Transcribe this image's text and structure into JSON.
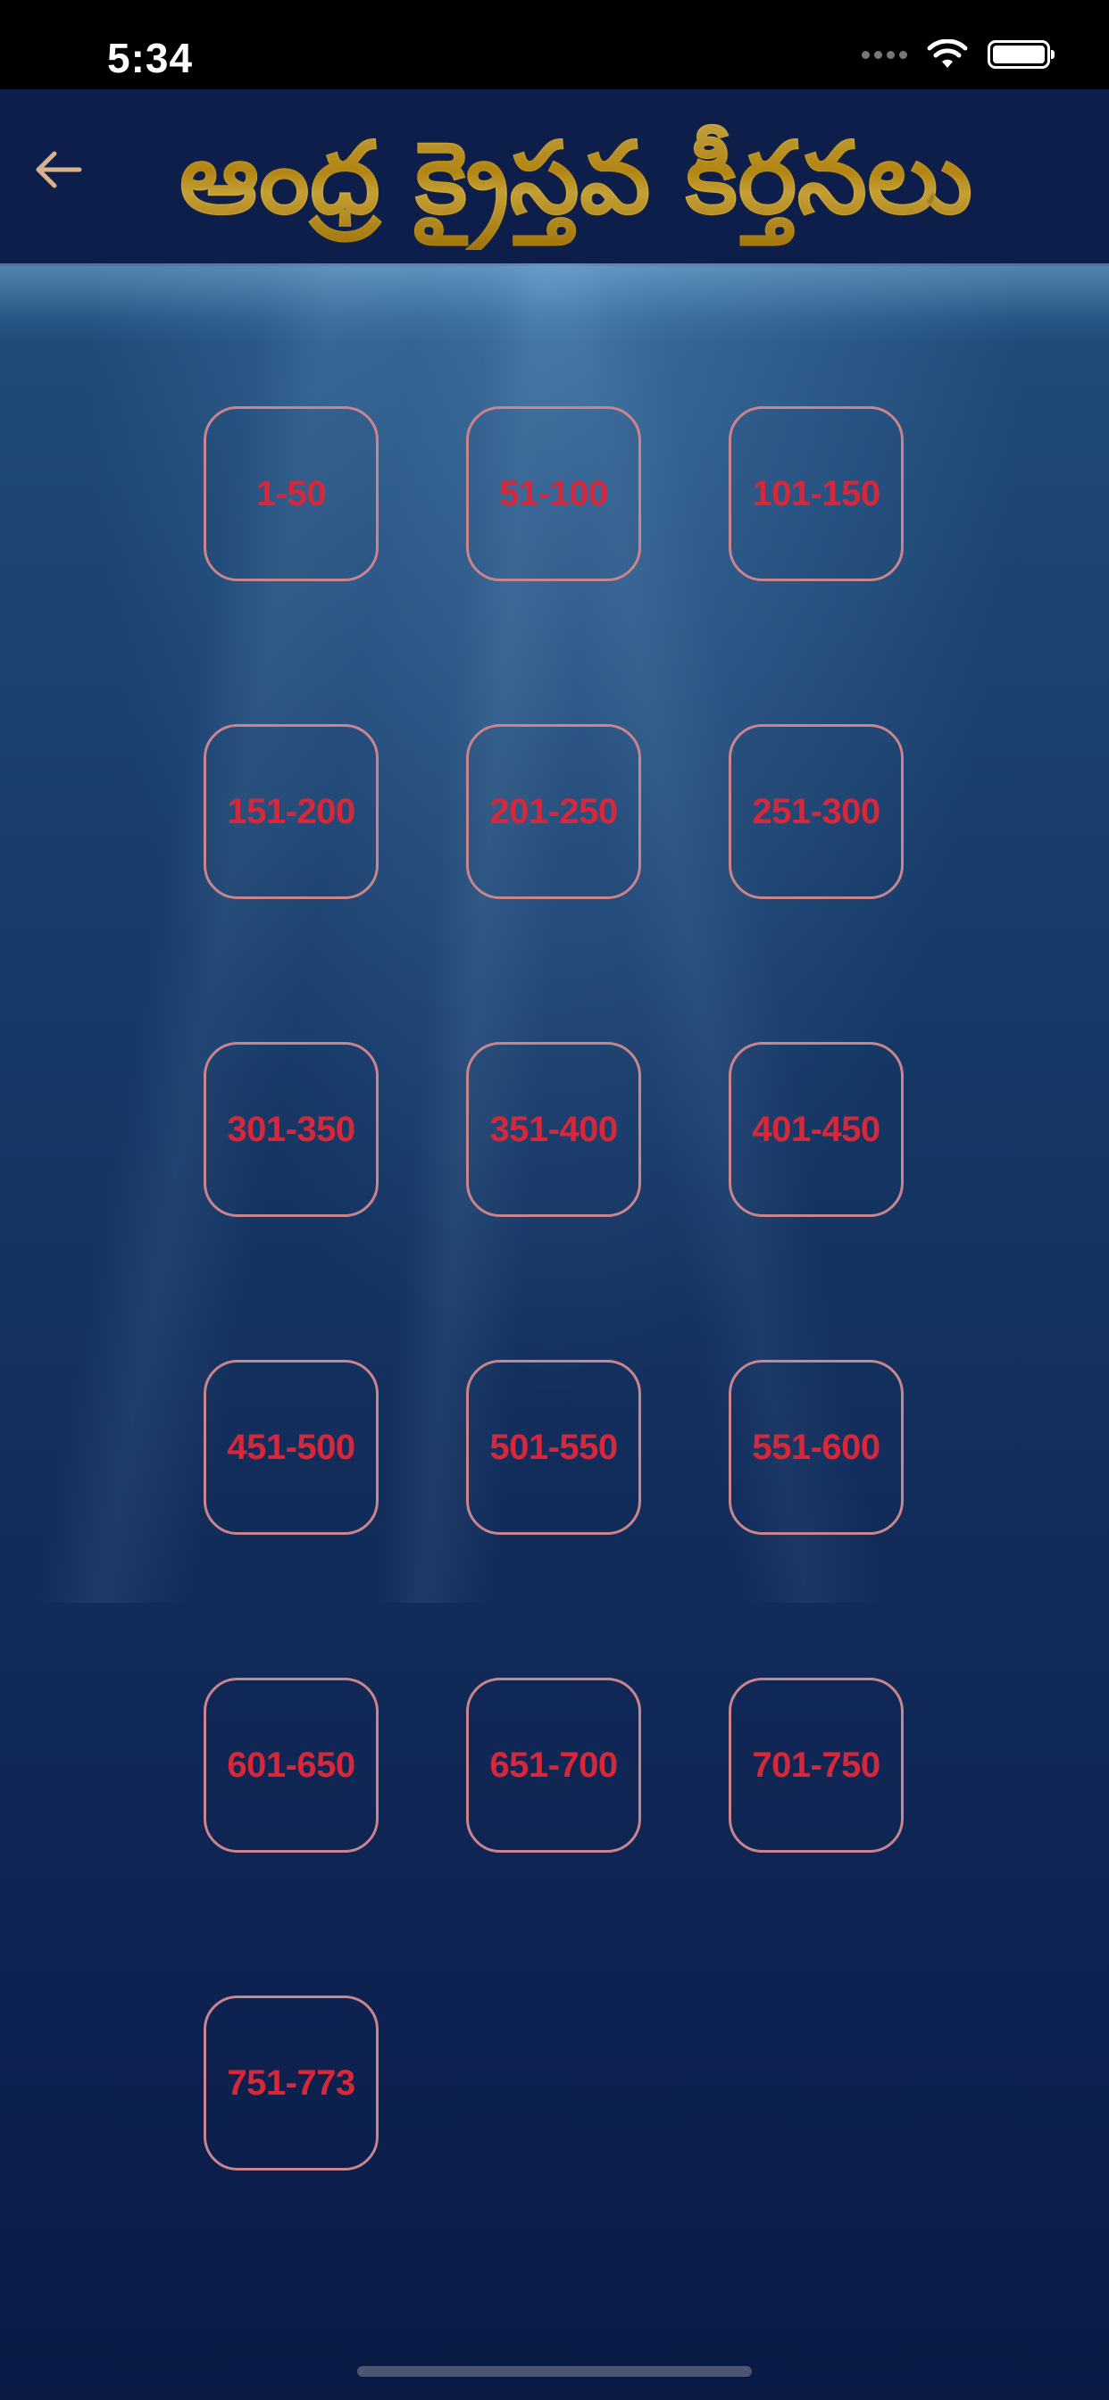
{
  "status_bar": {
    "time": "5:34"
  },
  "header": {
    "back_icon": "arrow-left-icon",
    "title": "ఆంధ్ర క్రైస్తవ కీర్తనలు"
  },
  "ranges": [
    {
      "label": "1-50"
    },
    {
      "label": "51-100"
    },
    {
      "label": "101-150"
    },
    {
      "label": "151-200"
    },
    {
      "label": "201-250"
    },
    {
      "label": "251-300"
    },
    {
      "label": "301-350"
    },
    {
      "label": "351-400"
    },
    {
      "label": "401-450"
    },
    {
      "label": "451-500"
    },
    {
      "label": "501-550"
    },
    {
      "label": "551-600"
    },
    {
      "label": "601-650"
    },
    {
      "label": "651-700"
    },
    {
      "label": "701-750"
    },
    {
      "label": "751-773"
    }
  ],
  "colors": {
    "tile_border": "#c9848c",
    "tile_text": "#d6283a",
    "title_gold": "#e8c23a",
    "header_bg": "#0e1e4a"
  }
}
